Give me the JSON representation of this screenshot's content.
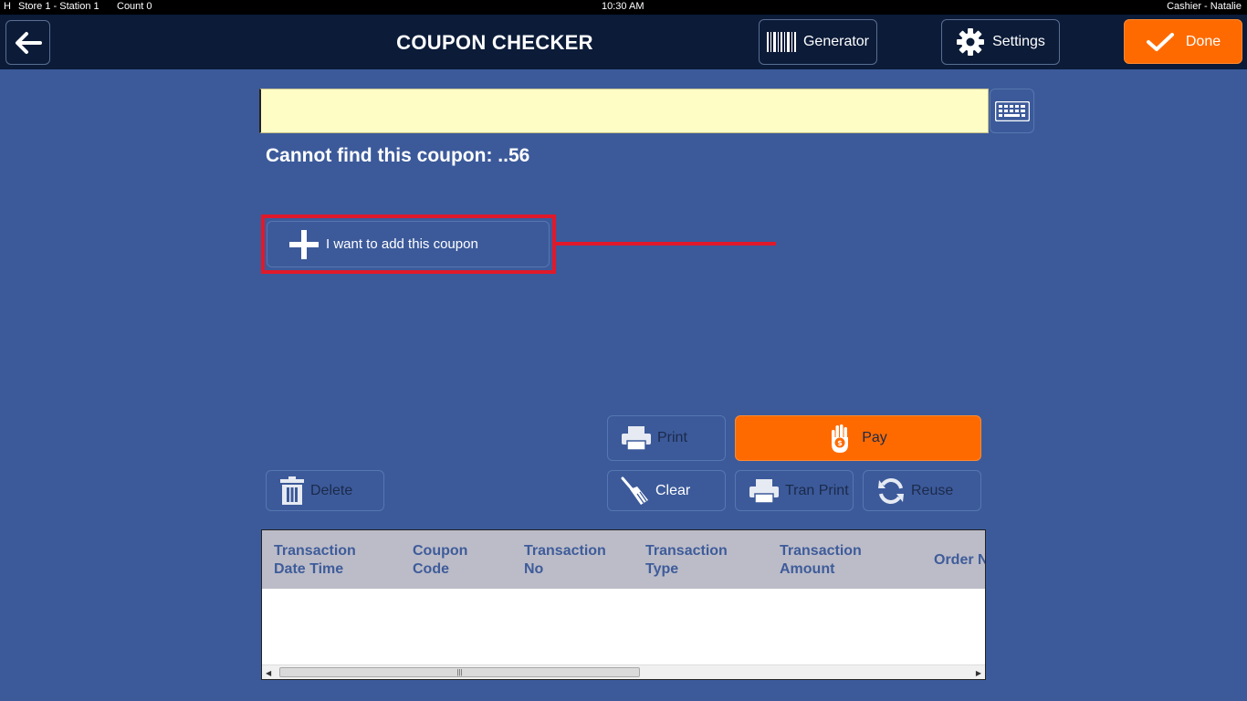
{
  "statusbar": {
    "h": "H",
    "store": "Store 1 - Station 1",
    "count": "Count 0",
    "time": "10:30 AM",
    "cashier": "Cashier - Natalie"
  },
  "header": {
    "title": "COUPON CHECKER",
    "generator_label": "Generator",
    "settings_label": "Settings",
    "done_label": "Done"
  },
  "search": {
    "value": "",
    "placeholder": ""
  },
  "message": "Cannot find this coupon: ..56",
  "add_coupon_label": "I want to add this coupon",
  "actions": {
    "print": "Print",
    "pay": "Pay",
    "delete": "Delete",
    "clear": "Clear",
    "tran_print": "Tran Print",
    "reuse": "Reuse"
  },
  "table": {
    "columns": [
      {
        "line1": "Transaction",
        "line2": "Date Time"
      },
      {
        "line1": "Coupon",
        "line2": "Code"
      },
      {
        "line1": "Transaction",
        "line2": "No"
      },
      {
        "line1": "Transaction",
        "line2": "Type"
      },
      {
        "line1": "Transaction",
        "line2": "Amount"
      },
      {
        "line1": "Order N",
        "line2": ""
      }
    ],
    "rows": []
  },
  "colors": {
    "background": "#3c5a9a",
    "header": "#0b1b38",
    "accent_orange": "#ff6a00",
    "highlight_red": "#e0192a",
    "input_yellow": "#fffdc6"
  }
}
